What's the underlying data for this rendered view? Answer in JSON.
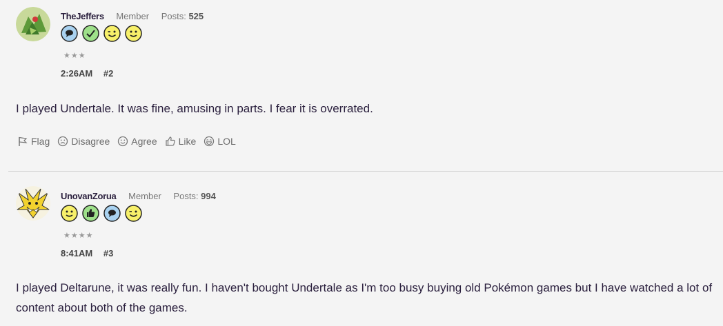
{
  "posts": [
    {
      "username": "TheJeffers",
      "role": "Member",
      "posts_label": "Posts:",
      "posts_count": "525",
      "rank": "★★★",
      "time": "2:26AM",
      "number": "#2",
      "body": "I played Undertale. It was fine, amusing in parts. I fear it is overrated.",
      "badges": [
        "speech-bubble",
        "checkmark",
        "wink",
        "smile"
      ],
      "avatar_color": "#8fbf4a"
    },
    {
      "username": "UnovanZorua",
      "role": "Member",
      "posts_label": "Posts:",
      "posts_count": "994",
      "rank": "★★★★",
      "time": "8:41AM",
      "number": "#3",
      "body": "I played Deltarune, it was really fun. I haven't bought Undertale as I'm too busy buying old Pokémon games but I have watched a lot of content about both of the games.",
      "badges": [
        "smile",
        "thumbs-up",
        "speech-bubble",
        "wink"
      ],
      "avatar_color": "#f2d22e"
    }
  ],
  "reactions": [
    {
      "label": "Flag",
      "icon": "flag-icon"
    },
    {
      "label": "Disagree",
      "icon": "frown-icon"
    },
    {
      "label": "Agree",
      "icon": "smile-icon"
    },
    {
      "label": "Like",
      "icon": "thumbs-up-icon"
    },
    {
      "label": "LOL",
      "icon": "laugh-icon"
    }
  ],
  "colors": {
    "text": "#2a1f3d",
    "badge_blue": "#a9d2f0",
    "badge_green": "#9ee08a",
    "badge_yellow": "#f7f06a"
  }
}
